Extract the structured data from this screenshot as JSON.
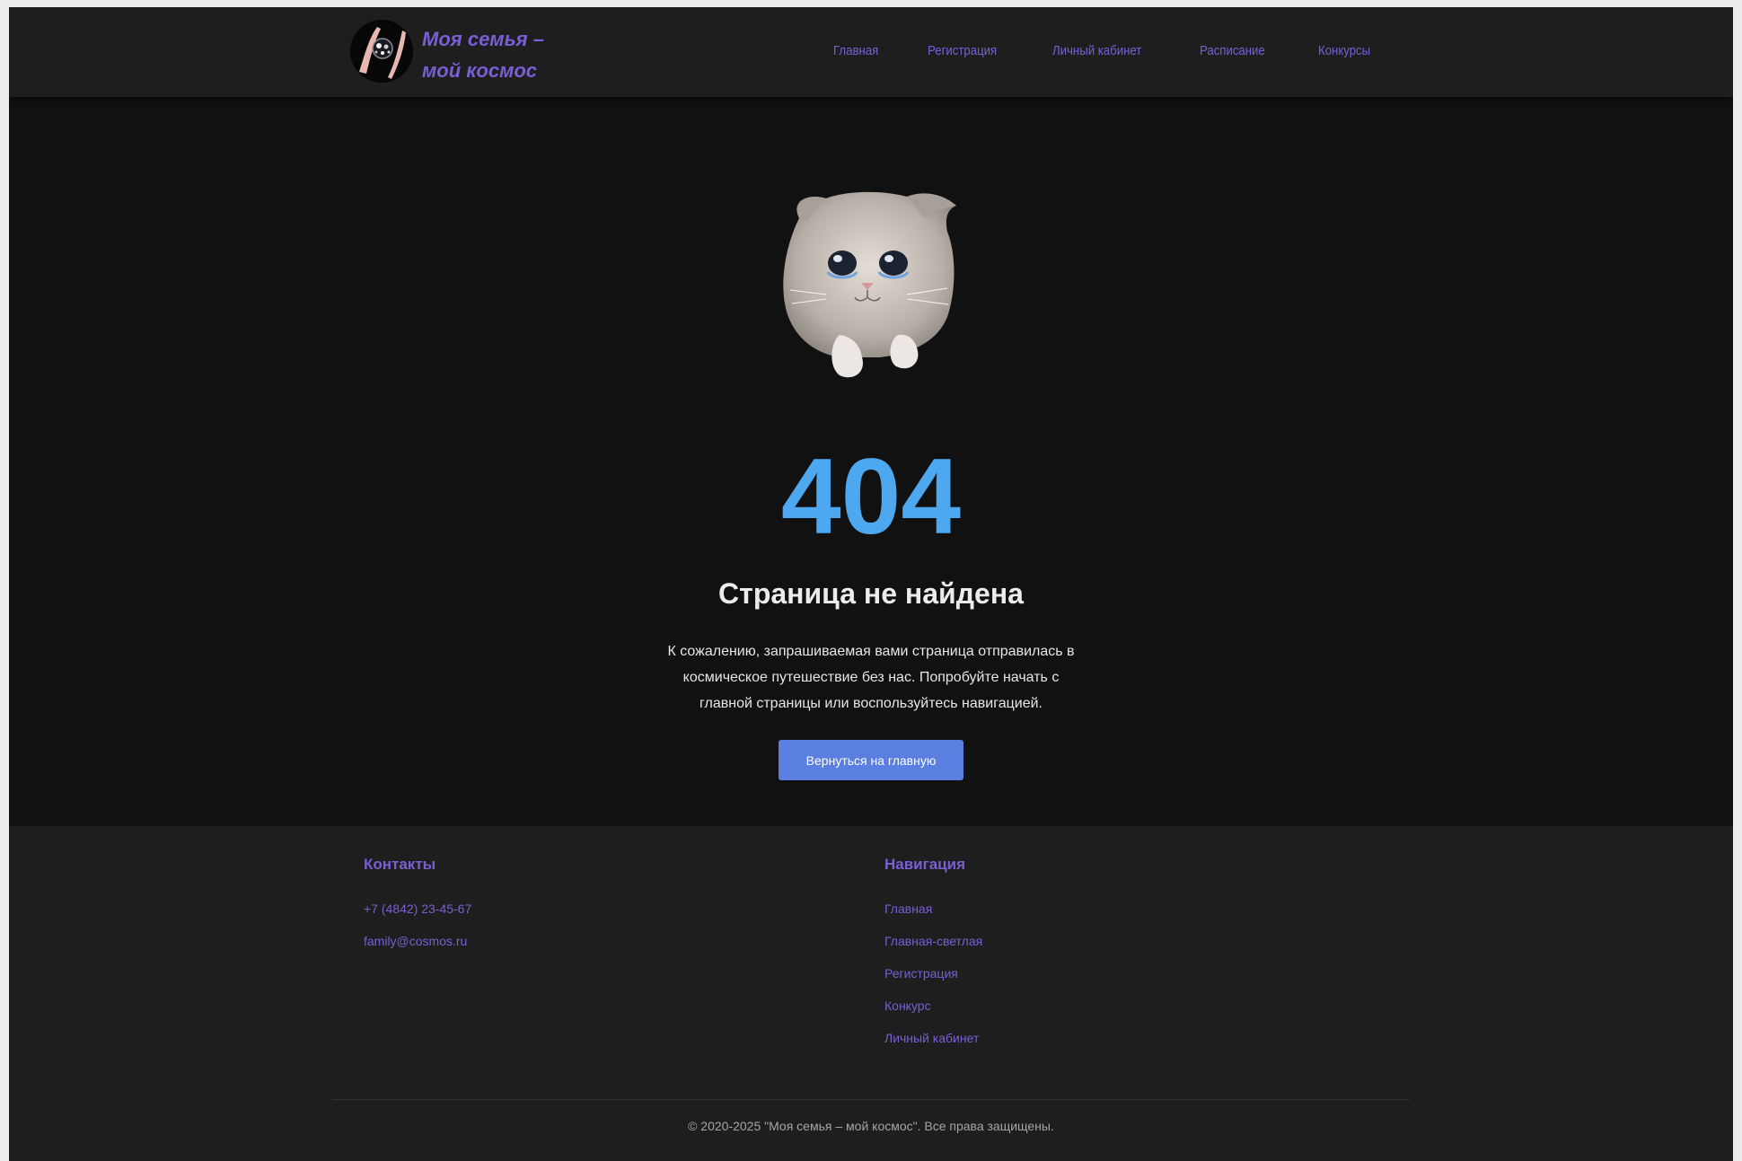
{
  "header": {
    "brand_line1": "Моя семья –",
    "brand_line2": "мой космос",
    "nav": [
      "Главная",
      "Регистрация",
      "Личный кабинет",
      "Расписание",
      "Конкурсы"
    ]
  },
  "main": {
    "error_code": "404",
    "title": "Страница не найдена",
    "description": "К сожалению, запрашиваемая вами страница отправилась в космическое путешествие без нас. Попробуйте начать с главной страницы или воспользуйтесь навигацией.",
    "button": "Вернуться на главную"
  },
  "footer": {
    "contacts_title": "Контакты",
    "phone": "+7 (4842) 23-45-67",
    "email": "family@cosmos.ru",
    "nav_title": "Навигация",
    "nav": [
      "Главная",
      "Главная-светлая",
      "Регистрация",
      "Конкурс",
      "Личный кабинет"
    ],
    "copyright": "© 2020-2025 \"Моя семья – мой космос\". Все права защищены."
  },
  "colors": {
    "accent": "#7a5fd4",
    "code": "#4da8f0",
    "button": "#5b7fe0",
    "background": "#111111",
    "panel": "#1e1e1f"
  },
  "icons": {
    "logo": "family-cosmos-logo",
    "illustration": "sad-cat-illustration"
  }
}
